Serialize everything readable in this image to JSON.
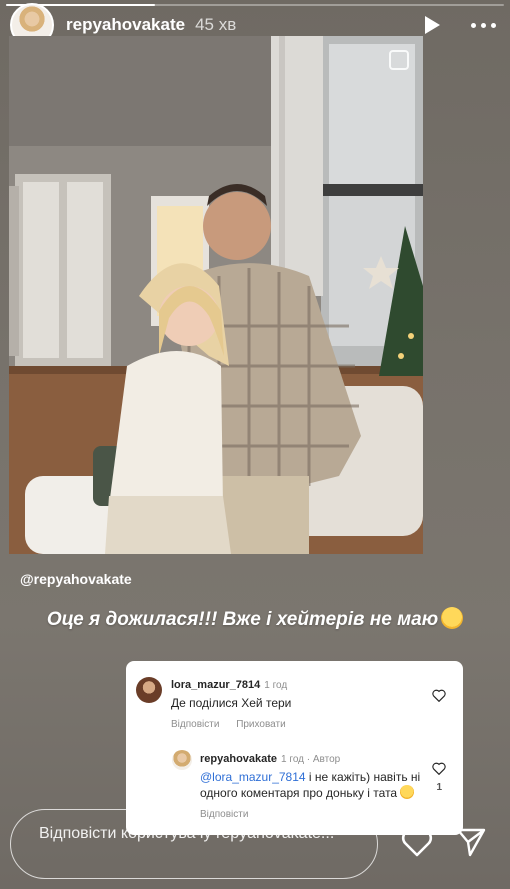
{
  "story": {
    "progress": 0.3
  },
  "header": {
    "username": "repyahovakate",
    "time": "45 хв",
    "play_icon": "play-icon",
    "more_icon": "more-options-icon"
  },
  "photo": {
    "description_icon": "select-icon"
  },
  "mention": "@repyahovakate",
  "caption": {
    "text": "Оце я дожилася!!! Вже і хейтерів не маю",
    "emoji": "sweat-smile-emoji"
  },
  "comments": [
    {
      "username": "lora_mazur_7814",
      "time": "1 год",
      "text": "Де поділися Хей тери",
      "actions": [
        "Відповісти",
        "Приховати"
      ]
    },
    {
      "username": "repyahovakate",
      "meta": "1 год · Автор",
      "mention": "@lora_mazur_7814",
      "text": " і не кажіть) навіть ні одного коментаря про доньку і тата",
      "actions": [
        "Відповісти"
      ],
      "likes": "1"
    }
  ],
  "reply": {
    "placeholder": "Відповісти користувачу repyahovakate..."
  },
  "colors": {
    "background": "#77726b",
    "link": "#2f6fd6",
    "card": "#ffffff"
  }
}
